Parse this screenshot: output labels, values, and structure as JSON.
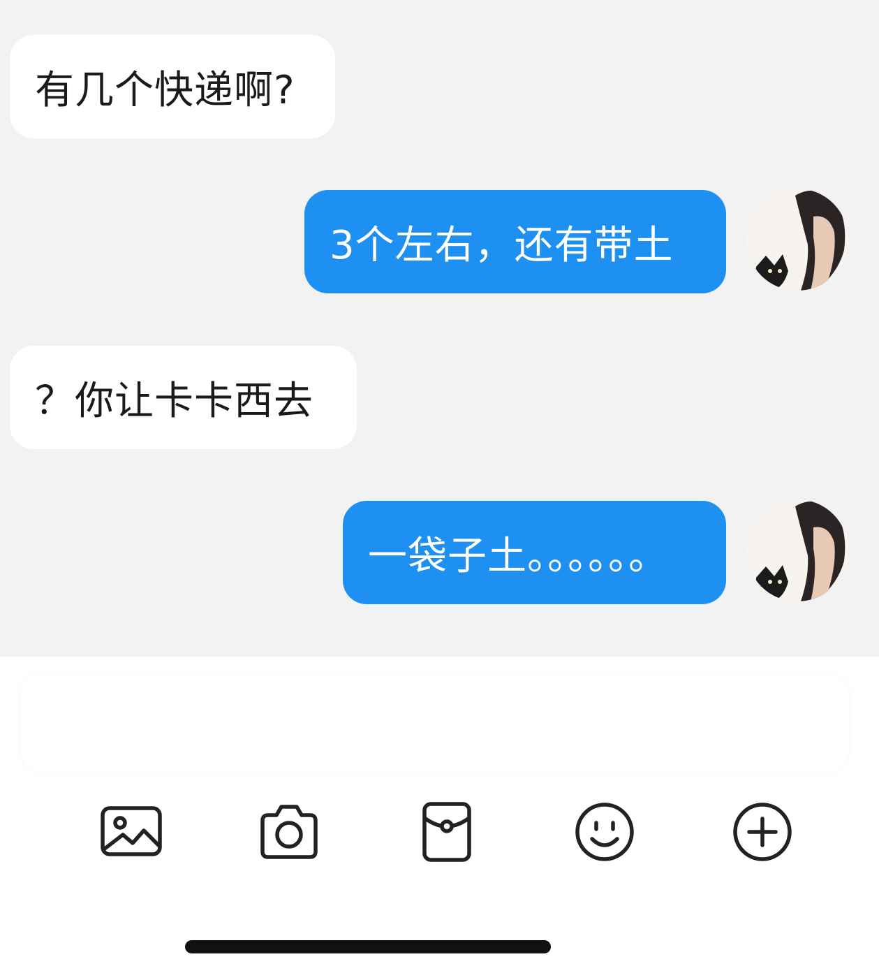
{
  "messages": [
    {
      "side": "incoming",
      "text": "有几个快递啊?"
    },
    {
      "side": "outgoing",
      "text": "3个左右，还有带土"
    },
    {
      "side": "incoming",
      "text": "？你让卡卡西去"
    },
    {
      "side": "outgoing",
      "text": "一袋子土。。。。。。"
    }
  ],
  "composer": {
    "input_value": ""
  },
  "toolbar": {
    "icons": [
      "image-icon",
      "camera-icon",
      "red-packet-icon",
      "emoji-icon",
      "plus-icon"
    ]
  },
  "colors": {
    "outgoing_bubble": "#1e90f2",
    "incoming_bubble": "#ffffff",
    "background": "#f2f2f2"
  }
}
